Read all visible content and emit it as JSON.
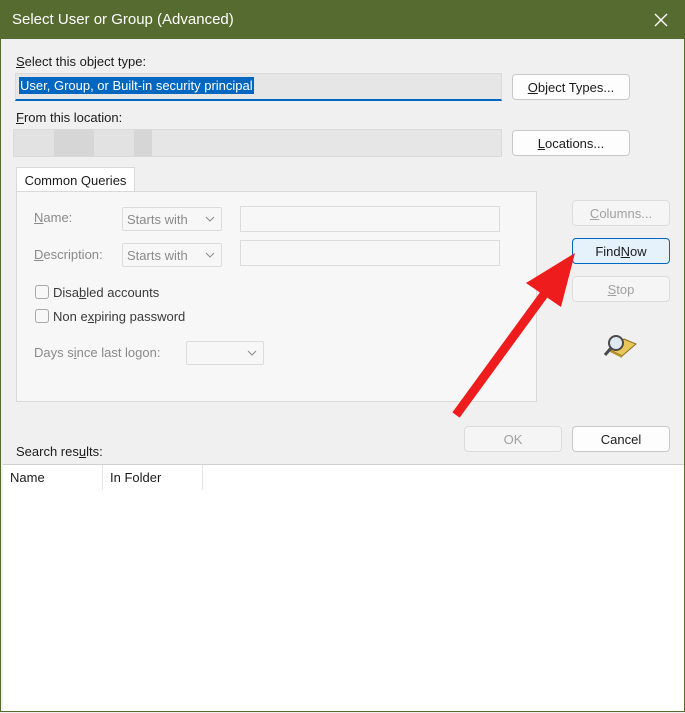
{
  "window": {
    "title": "Select User or Group (Advanced)",
    "close_icon": "close-icon"
  },
  "object_type": {
    "label_prefix": "S",
    "label_rest": "elect this object type:",
    "value": "User, Group, or Built-in security principal",
    "button_prefix": "O",
    "button_rest": "bject Types..."
  },
  "location": {
    "label_prefix": "F",
    "label_rest": "rom this location:",
    "value": "",
    "button_prefix": "L",
    "button_rest": "ocations..."
  },
  "common_queries": {
    "tab_label": "Common Queries",
    "name_label_prefix": "N",
    "name_label_rest": "ame:",
    "name_mode": "Starts with",
    "description_label_prefix": "D",
    "description_label_rest": "escription:",
    "description_mode": "Starts with",
    "disabled_accounts_pre": "Disa",
    "disabled_accounts_u": "b",
    "disabled_accounts_post": "led accounts",
    "non_expiring_pre": "Non e",
    "non_expiring_u": "x",
    "non_expiring_post": "piring password",
    "days_label_pre": "Days s",
    "days_label_u": "i",
    "days_label_post": "nce last logon:"
  },
  "side_buttons": {
    "columns_prefix": "C",
    "columns_rest": "olumns...",
    "find_now_pre": "Find ",
    "find_now_u": "N",
    "find_now_post": "ow",
    "stop_prefix": "S",
    "stop_rest": "top",
    "search_icon": "search-flashlight-icon"
  },
  "footer": {
    "ok_label": "OK",
    "cancel_label": "Cancel"
  },
  "results": {
    "label_pre": "Search res",
    "label_u": "u",
    "label_post": "lts:",
    "columns": [
      "Name",
      "In Folder"
    ]
  },
  "annotation": {
    "arrow_color": "#ee1c1c"
  }
}
